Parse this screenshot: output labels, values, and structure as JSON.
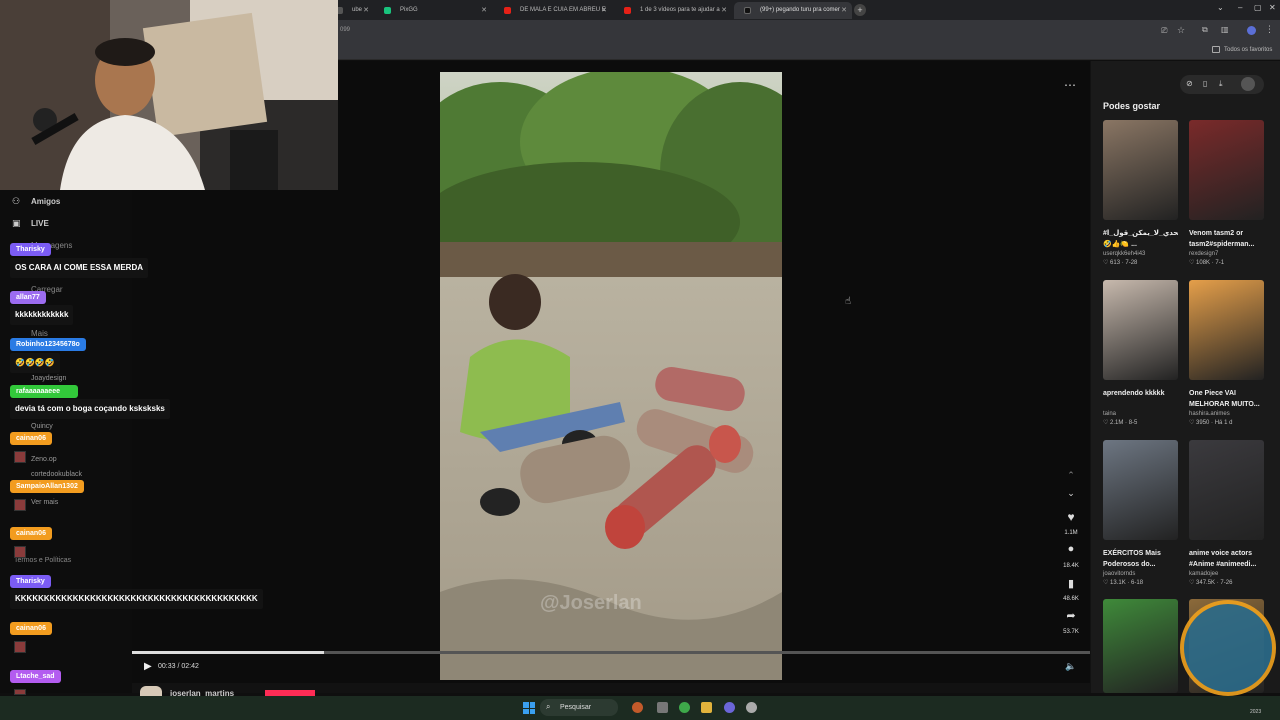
{
  "browser": {
    "tabs": [
      {
        "label": "ube",
        "color": "#555"
      },
      {
        "label": "PixGG",
        "color": "#19c37d"
      },
      {
        "label": "DE MALA E CUIA EM ABREU E",
        "color": "#e62117"
      },
      {
        "label": "1 de 3 vídeos para te ajudar a",
        "color": "#e62117"
      },
      {
        "label": "(99+) pegando turu pra comer",
        "color": "#111"
      }
    ],
    "url_fragment": "099",
    "bookmarks_label": "Todos os favoritos"
  },
  "webcam": {
    "name": "webcam-feed"
  },
  "left_nav": {
    "items": [
      "Amigos",
      "LIVE",
      "Mensagens",
      "Carregar",
      "Mais"
    ],
    "accounts": [
      "Joaydesign",
      "Quincy",
      "Zeno.op",
      "cortedookublack",
      "Ver mais"
    ],
    "footer": "Termos e Políticas"
  },
  "chat": [
    {
      "user": "Tharisky",
      "user_color": "#7b5cf5",
      "text": "OS CARA AI COME ESSA MERDA"
    },
    {
      "user": "allan77",
      "user_color": "#9c6cf0",
      "text": "kkkkkkkkkkkk"
    },
    {
      "user": "Robinho12345678o",
      "user_color": "#2a7be4",
      "text": "🤣🤣🤣🤣"
    },
    {
      "user": "rafaaaaaaeee",
      "user_color": "#32c83a",
      "text": "devia tá com o boga coçando ksksksks"
    },
    {
      "user": "cainan06",
      "user_color": "#f29c1f",
      "text": ""
    },
    {
      "user": "SampaioAllan1302",
      "user_color": "#f29c1f",
      "text": ""
    },
    {
      "user": "cainan06",
      "user_color": "#f29c1f",
      "text": ""
    },
    {
      "user": "Tharisky",
      "user_color": "#7b5cf5",
      "text": "KKKKKKKKKKKKKKKKKKKKKKKKKKKKKKKKKKKKKKKKKK"
    },
    {
      "user": "cainan06",
      "user_color": "#f29c1f",
      "text": ""
    },
    {
      "user": "Ltache_sad",
      "user_color": "#b35cf0",
      "text": ""
    }
  ],
  "player": {
    "time": "00:33 / 02:42",
    "progress": 0.2,
    "watermark": "@Joserlan",
    "author": "joserlan_martins",
    "actions": [
      {
        "icon": "heart-icon",
        "count": "1.1M"
      },
      {
        "icon": "comment-icon",
        "count": "18.4K"
      },
      {
        "icon": "bookmark-icon",
        "count": "48.6K"
      },
      {
        "icon": "share-icon",
        "count": "53.7K"
      }
    ]
  },
  "sidebar": {
    "title": "Podes gostar",
    "cards": [
      {
        "title": "#تحدي_لا_يمكن_قول_ا 🤣👍🍋 ...",
        "author": "userqkk6eh4i43",
        "stats": "♡ 613 · 7-28",
        "color": "#8a7664"
      },
      {
        "title": "Venom tasm2 or tasm2#spiderman...",
        "author": "rexdesign7",
        "stats": "♡ 108K · 7-1",
        "color": "#7a2a2a"
      },
      {
        "title": "aprendendo kkkkk",
        "author": "taina",
        "stats": "♡ 2.1M · 8-5",
        "color": "#c7b9ad"
      },
      {
        "title": "One Piece VAI MELHORAR MUITO...",
        "author": "hashira.animes",
        "stats": "♡ 3950 · Há 1 d",
        "color": "#e59f4a"
      },
      {
        "title": "EXÉRCITOS Mais Poderosos do...",
        "author": "joaovitornds",
        "stats": "♡ 13.1K · 6-18",
        "color": "#6d7682"
      },
      {
        "title": "anime voice actors #Anime #animeedi...",
        "author": "kamadojee",
        "stats": "♡ 347.5K · 7-26",
        "color": "#3b3a3e"
      },
      {
        "title": "",
        "author": "",
        "stats": "",
        "color": "#3f8a3a"
      },
      {
        "title": "",
        "author": "",
        "stats": "",
        "color": "#8c6a3a"
      }
    ]
  },
  "taskbar": {
    "search_label": "Pesquisar",
    "clock": "2023"
  }
}
